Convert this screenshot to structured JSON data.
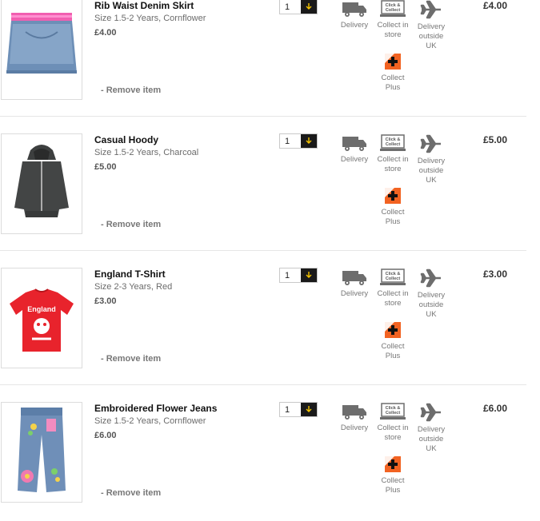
{
  "items": [
    {
      "name": "Rib Waist Denim Skirt",
      "size": "Size 1.5-2 Years, Cornflower",
      "price": "£4.00",
      "qty": "1",
      "total": "£4.00",
      "remove_label": "- Remove item",
      "image": "denim-skirt"
    },
    {
      "name": "Casual Hoody",
      "size": "Size 1.5-2 Years, Charcoal",
      "price": "£5.00",
      "qty": "1",
      "total": "£5.00",
      "remove_label": "- Remove item",
      "image": "hoody"
    },
    {
      "name": "England T-Shirt",
      "size": "Size 2-3 Years, Red",
      "price": "£3.00",
      "qty": "1",
      "total": "£3.00",
      "remove_label": "- Remove item",
      "image": "england-tshirt",
      "image_text": "England"
    },
    {
      "name": "Embroidered Flower Jeans",
      "size": "Size 1.5-2 Years, Cornflower",
      "price": "£6.00",
      "qty": "1",
      "total": "£6.00",
      "remove_label": "- Remove item",
      "image": "flower-jeans"
    }
  ],
  "options": {
    "delivery": "Delivery",
    "click_collect_line1": "Collect in",
    "click_collect_line2": "store",
    "outside_line1": "Delivery",
    "outside_line2": "outside UK",
    "collect_plus_line1": "Collect",
    "collect_plus_line2": "Plus",
    "click_collect_badge_line1": "Click &",
    "click_collect_badge_line2": "Collect"
  },
  "colors": {
    "qty_button": "#1a1a1a",
    "qty_arrow": "#f5c400",
    "collect_plus": "#f26322",
    "icon_grey": "#6d6d6d"
  }
}
